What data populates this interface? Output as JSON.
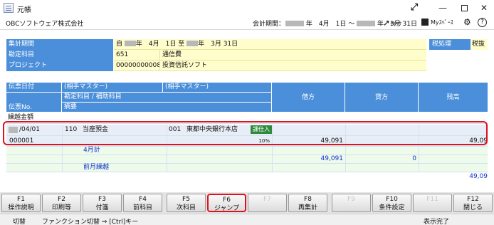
{
  "window": {
    "title": "元帳",
    "expand_glyph": "⤢",
    "min_glyph": "—",
    "close_glyph": "✕"
  },
  "header": {
    "company": "OBCソフトウェア株式会社",
    "period_label": "会計期間：",
    "period_from": "年　4月　1日 ～",
    "period_to": "年　3月 31日",
    "quick_label": "ｸｲｯｸ",
    "myspace_label": "Myｽﾍﾟｰｽ",
    "help_glyph": "?"
  },
  "conditions": {
    "agg_label": "集計期間",
    "agg_from_prefix": "自",
    "agg_from": "年　4月　1日",
    "agg_sep": "至",
    "agg_to": "年　3月 31日",
    "account_label": "勘定科目",
    "account_code": "651",
    "account_name": "通信費",
    "project_label": "プロジェクト",
    "project_code": "00000000008",
    "project_name": "投資信託ソフト",
    "tax_label": "税処理",
    "tax_value": "税抜"
  },
  "grid": {
    "headers": {
      "date": "伝票日付",
      "partner1": "(相手マスター)",
      "partner2": "(相手マスター)",
      "account_sub": "勘定科目 / 補助科目",
      "slip_no": "伝票No.",
      "summary": "摘要",
      "debit": "借方",
      "credit": "貸方",
      "balance": "残高"
    },
    "carryover_label": "繰越金額",
    "row": {
      "date": "/04/01",
      "acct_code": "110",
      "acct_name": "当座預金",
      "bank_code": "001",
      "bank_name": "東都中央銀行本店",
      "badge": "課仕入",
      "slip_no": "000001",
      "tax_rate": "10%",
      "debit": "49,091",
      "balance": "49,09"
    },
    "month_total": {
      "label": "4月計",
      "debit": "49,091",
      "credit": "0"
    },
    "prev_carry": {
      "label": "前月繰越",
      "balance": "49,09"
    }
  },
  "fkeys": [
    {
      "key": "F1",
      "label": "操作説明"
    },
    {
      "key": "F2",
      "label": "印刷等"
    },
    {
      "key": "F3",
      "label": "付箋"
    },
    {
      "key": "F4",
      "label": "前科目"
    },
    {
      "key": "F5",
      "label": "次科目"
    },
    {
      "key": "F6",
      "label": "ジャンプ"
    },
    {
      "key": "F7",
      "label": ""
    },
    {
      "key": "F8",
      "label": "再集計"
    },
    {
      "key": "F9",
      "label": ""
    },
    {
      "key": "F10",
      "label": "条件設定"
    },
    {
      "key": "F11",
      "label": ""
    },
    {
      "key": "F12",
      "label": "閉じる"
    }
  ],
  "status": {
    "mode": "切替",
    "hint": "ファンクション切替 ⇒ [Ctrl]キー",
    "state": "表示完了"
  }
}
